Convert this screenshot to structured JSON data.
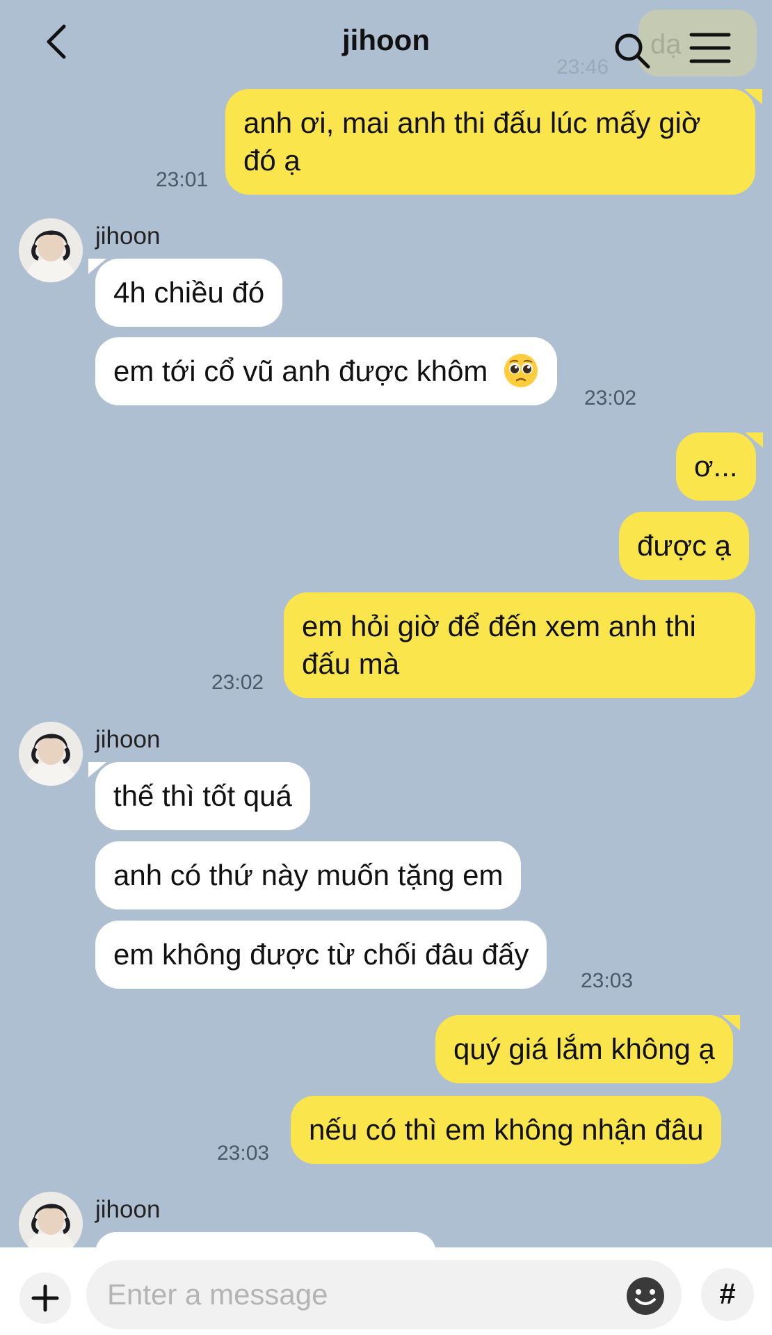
{
  "header": {
    "title": "jihoon",
    "ghost_text": "dạ",
    "ghost_time": "23:46"
  },
  "messages": [
    {
      "lines": [
        "anh ơi, mai anh thi đấu lúc mấy giờ",
        "đó ạ"
      ],
      "time": "23:01"
    },
    {
      "sender": "jihoon"
    },
    {
      "text": "4h chiều đó"
    },
    {
      "text": "em tới cổ vũ anh được khôm",
      "time": "23:02"
    },
    {
      "text": "ơ..."
    },
    {
      "text": "được ạ"
    },
    {
      "lines": [
        "em hỏi giờ để đến xem anh thi",
        "đấu mà"
      ],
      "time": "23:02"
    },
    {
      "sender": "jihoon"
    },
    {
      "text": "thế thì tốt quá"
    },
    {
      "text": "anh có thứ này muốn tặng em"
    },
    {
      "text": "em không được từ chối đâu đấy",
      "time": "23:03"
    },
    {
      "text": "quý giá lắm không ạ"
    },
    {
      "text": "nếu có thì em không nhận đâu",
      "time": "23:03"
    },
    {
      "sender": "jihoon"
    }
  ],
  "footer": {
    "placeholder": "Enter a message",
    "hash": "#"
  },
  "icons": {
    "back": "chevron-left-icon",
    "search": "search-icon",
    "menu": "menu-icon",
    "emoji": "pleading-face-emoji",
    "plus": "plus-icon",
    "smile": "smile-icon",
    "hash": "hash-icon"
  },
  "colors": {
    "background": "#aebfd1",
    "outgoing_bubble": "#fae54c",
    "incoming_bubble": "#ffffff"
  }
}
